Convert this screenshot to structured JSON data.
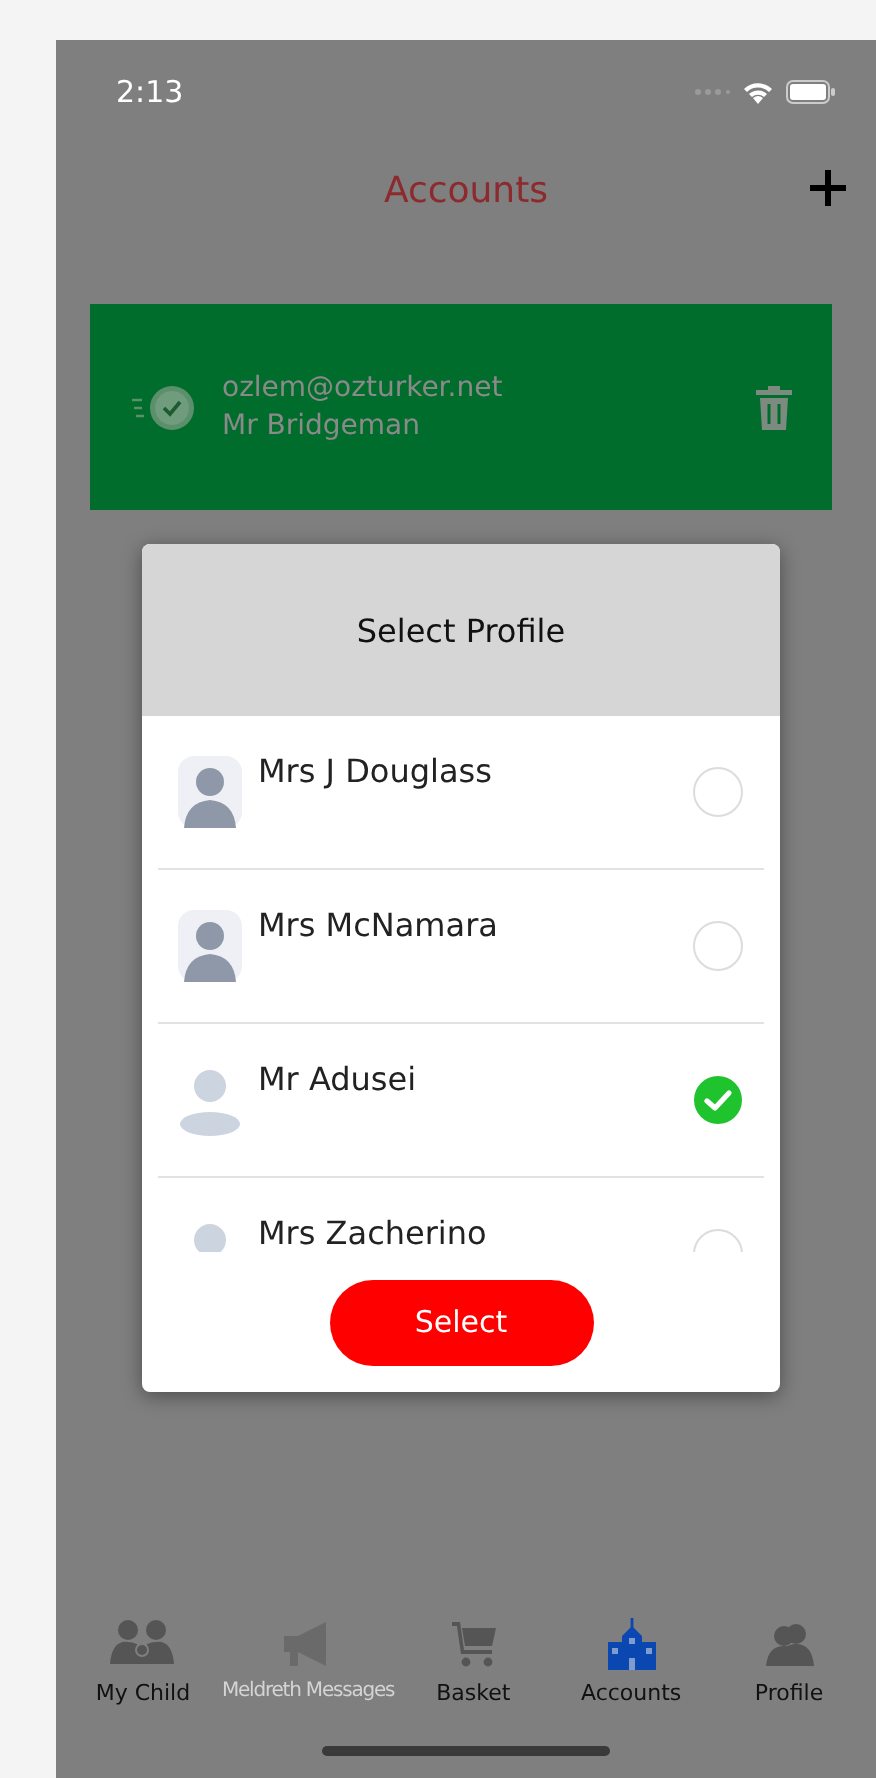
{
  "status_bar": {
    "time": "2:13"
  },
  "header": {
    "title": "Accounts"
  },
  "account": {
    "email": "ozlem@ozturker.net",
    "name": "Mr Bridgeman"
  },
  "dialog": {
    "title": "Select Profile",
    "button": "Select",
    "profiles": [
      {
        "name": "Mrs J Douglass",
        "kind": "framed",
        "selected": false
      },
      {
        "name": "Mrs McNamara",
        "kind": "framed",
        "selected": false
      },
      {
        "name": "Mr Adusei",
        "kind": "plain",
        "selected": true
      },
      {
        "name": "Mrs Zacherino",
        "kind": "plain",
        "selected": false
      }
    ]
  },
  "tabs": [
    {
      "label": "My Child",
      "kind": "children",
      "selected": false,
      "disabled": false
    },
    {
      "label": "Meldreth Messages",
      "kind": "megaphone",
      "selected": false,
      "disabled": true
    },
    {
      "label": "Basket",
      "kind": "cart",
      "selected": false,
      "disabled": false
    },
    {
      "label": "Accounts",
      "kind": "school",
      "selected": true,
      "disabled": false
    },
    {
      "label": "Profile",
      "kind": "people",
      "selected": false,
      "disabled": false
    }
  ]
}
